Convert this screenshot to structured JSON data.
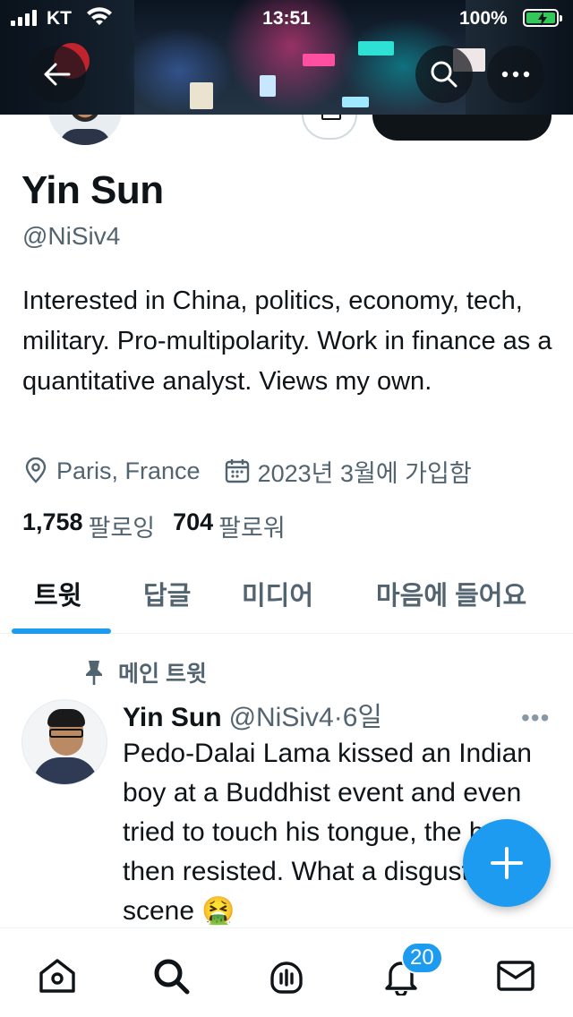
{
  "status_bar": {
    "carrier": "KT",
    "time": "13:51",
    "battery": "100%"
  },
  "profile": {
    "name": "Yin Sun",
    "handle": "@NiSiv4",
    "bio": "Interested in China, politics, economy, tech, military. Pro-multipolarity. Work in finance as a quantitative analyst. Views my own.",
    "location": "Paris, France",
    "joined": "2023년 3월에 가입함",
    "following_count": "1,758",
    "following_label": "팔로잉",
    "followers_count": "704",
    "followers_label": "팔로워"
  },
  "tabs": [
    {
      "label": "트윗",
      "active": true
    },
    {
      "label": "답글",
      "active": false
    },
    {
      "label": "미디어",
      "active": false
    },
    {
      "label": "마음에 들어요",
      "active": false
    }
  ],
  "pinned_tweet": {
    "pinned_label": "메인 트윗",
    "author_name": "Yin Sun",
    "author_handle": "@NiSiv4",
    "age": "·6일",
    "text": "Pedo-Dalai Lama kissed an Indian boy at a Buddhist event and even tried to touch his tongue, the boy then resisted. What a disgusting scene 🤮"
  },
  "notifications_badge": "20",
  "icons": {
    "back": "arrow-left-icon",
    "search": "search-icon",
    "more": "more-horizontal-icon",
    "location": "location-pin-icon",
    "calendar": "calendar-icon",
    "pin": "pin-icon",
    "compose": "plus-icon",
    "home": "home-icon",
    "explore": "search-icon",
    "spaces": "microphone-icon",
    "notifications": "bell-icon",
    "messages": "envelope-icon"
  },
  "colors": {
    "accent": "#1d9bf0",
    "text": "#0f1419",
    "secondary": "#536471"
  }
}
